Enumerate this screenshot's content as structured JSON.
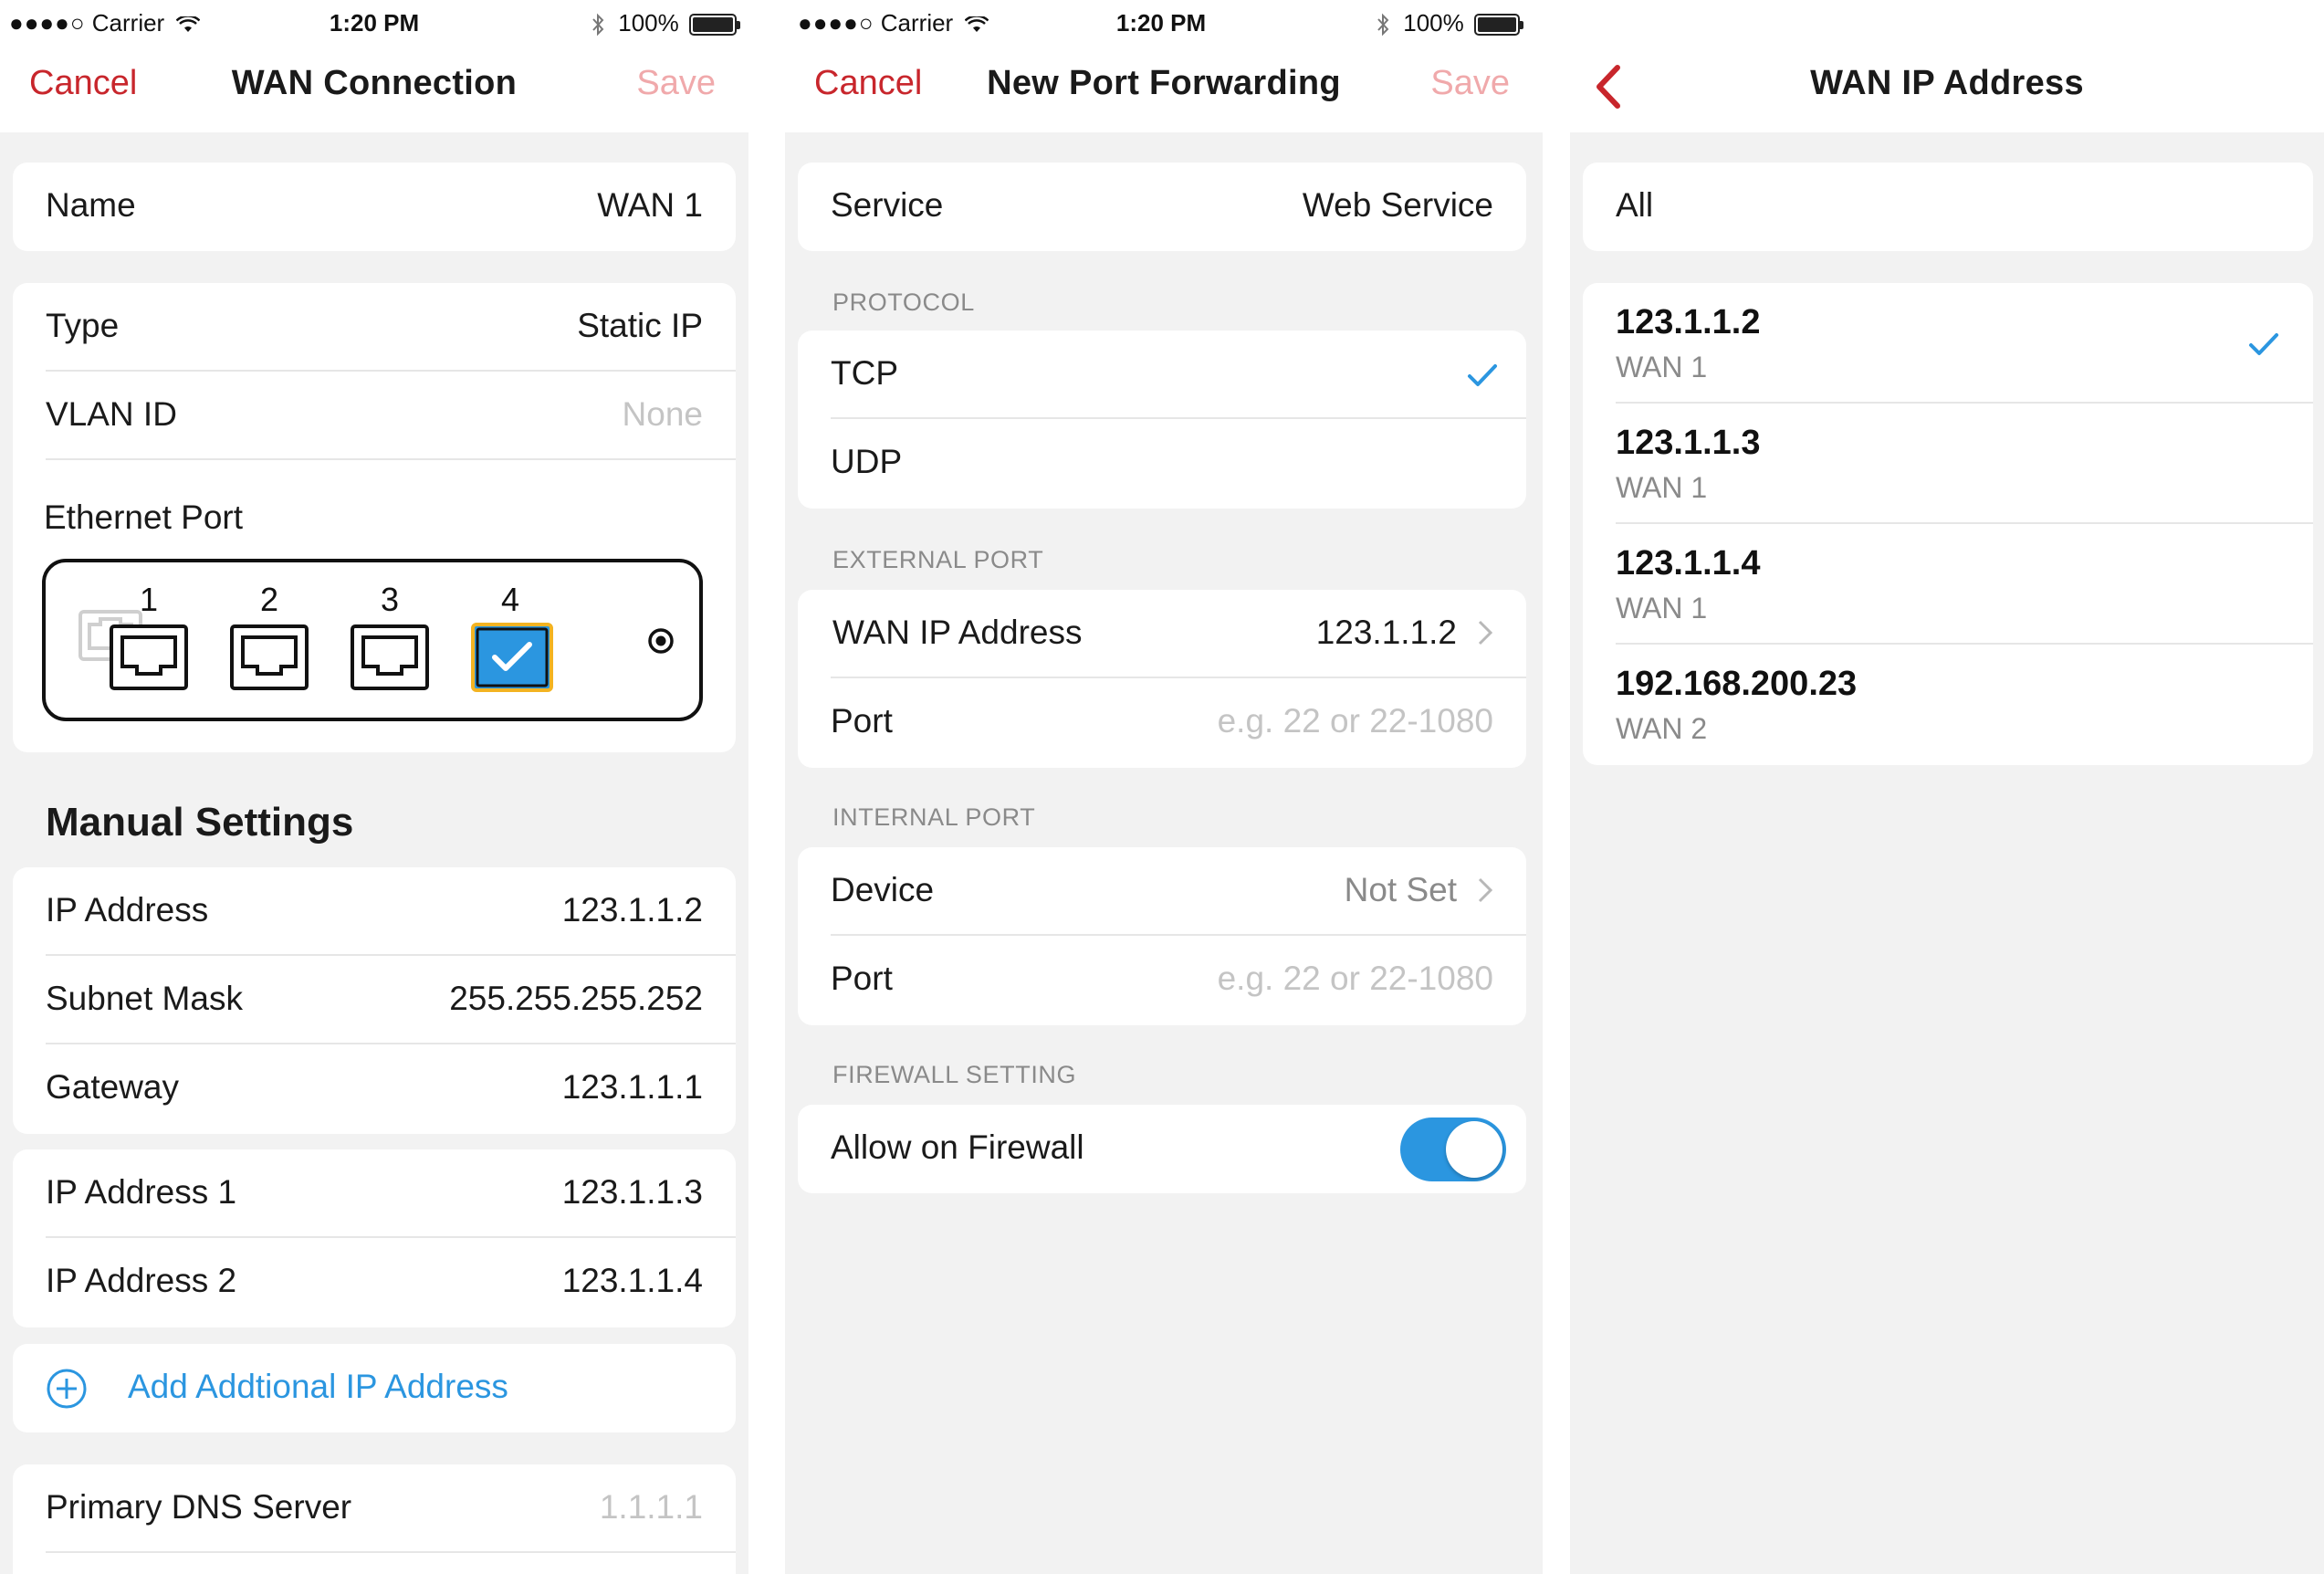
{
  "status": {
    "carrier": "Carrier",
    "time": "1:20 PM",
    "battery": "100%",
    "battery_level": 1.0
  },
  "wan_connection": {
    "nav": {
      "cancel": "Cancel",
      "title": "WAN Connection",
      "save": "Save"
    },
    "name_row": {
      "label": "Name",
      "value": "WAN 1"
    },
    "type_row": {
      "label": "Type",
      "value": "Static IP"
    },
    "vlan_row": {
      "label": "VLAN ID",
      "placeholder": "None"
    },
    "ethernet": {
      "label": "Ethernet Port",
      "ports": [
        "1",
        "2",
        "3",
        "4"
      ],
      "selected": "4"
    },
    "manual_heading": "Manual Settings",
    "ip_row": {
      "label": "IP Address",
      "value": "123.1.1.2"
    },
    "subnet_row": {
      "label": "Subnet Mask",
      "value": "255.255.255.252"
    },
    "gateway_row": {
      "label": "Gateway",
      "value": "123.1.1.1"
    },
    "ip1_row": {
      "label": "IP Address 1",
      "value": "123.1.1.3"
    },
    "ip2_row": {
      "label": "IP Address 2",
      "value": "123.1.1.4"
    },
    "add_ip": "Add Addtional IP Address",
    "dns_row": {
      "label": "Primary DNS Server",
      "placeholder": "1.1.1.1"
    }
  },
  "port_forwarding": {
    "nav": {
      "cancel": "Cancel",
      "title": "New Port Forwarding",
      "save": "Save"
    },
    "service_row": {
      "label": "Service",
      "value": "Web Service"
    },
    "protocol_section": "PROTOCOL",
    "protocols": [
      "TCP",
      "UDP"
    ],
    "selected_protocol": "TCP",
    "external_section": "EXTERNAL PORT",
    "wan_ip_row": {
      "label": "WAN IP Address",
      "value": "123.1.1.2"
    },
    "ext_port_row": {
      "label": "Port",
      "placeholder": "e.g. 22 or 22-1080"
    },
    "internal_section": "INTERNAL PORT",
    "device_row": {
      "label": "Device",
      "value": "Not Set"
    },
    "int_port_row": {
      "label": "Port",
      "placeholder": "e.g. 22 or 22-1080"
    },
    "firewall_section": "FIREWALL SETTING",
    "firewall_row": {
      "label": "Allow on Firewall",
      "enabled": true
    }
  },
  "wan_ip_address": {
    "nav": {
      "title": "WAN IP Address"
    },
    "all_row": "All",
    "addresses": [
      {
        "ip": "123.1.1.2",
        "wan": "WAN 1",
        "selected": true
      },
      {
        "ip": "123.1.1.3",
        "wan": "WAN 1",
        "selected": false
      },
      {
        "ip": "123.1.1.4",
        "wan": "WAN 1",
        "selected": false
      },
      {
        "ip": "192.168.200.23",
        "wan": "WAN 2",
        "selected": false
      }
    ]
  },
  "colors": {
    "accent_red": "#c8262c",
    "accent_blue": "#2b96e0",
    "save_disabled": "#f0a9ab",
    "selected_port_border": "#f3b321"
  }
}
